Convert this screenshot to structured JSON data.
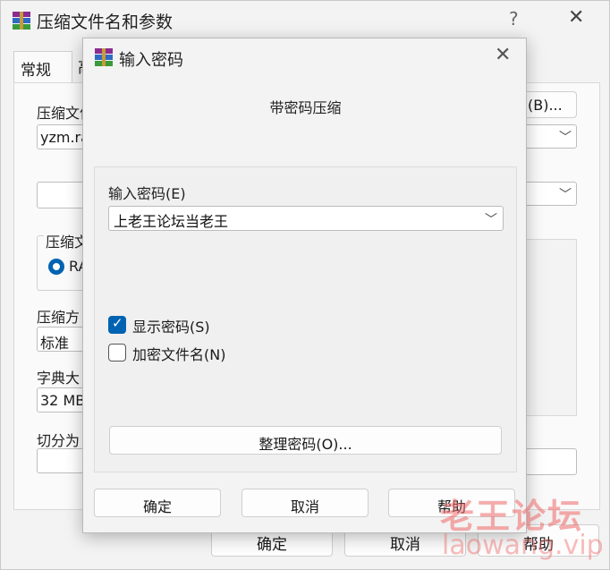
{
  "background_window": {
    "title": "压缩文件名和参数",
    "help_button": "?",
    "close_button": "✕",
    "tabs": [
      "常规",
      "高"
    ],
    "archive_name_label": "压缩文件",
    "archive_name_value": "yzm.ra",
    "browse_button": "(B)...",
    "archive_format_group": "压缩文",
    "archive_format_radio": "RA",
    "compression_method_label": "压缩方",
    "compression_method_value": "标准",
    "dictionary_size_label": "字典大",
    "dictionary_size_value": "32 MB",
    "split_label": "切分为",
    "buttons": {
      "ok": "确定",
      "cancel": "取消",
      "help": "帮助"
    }
  },
  "dialog": {
    "title": "输入密码",
    "close_button": "✕",
    "header": "带密码压缩",
    "password_label": "输入密码(E)",
    "password_value": "上老王论坛当老王",
    "show_password": {
      "label": "显示密码(S)",
      "checked": true
    },
    "encrypt_file_names": {
      "label": "加密文件名(N)",
      "checked": false
    },
    "organize_button": "整理密码(O)...",
    "buttons": {
      "ok": "确定",
      "cancel": "取消",
      "help": "帮助"
    }
  },
  "watermark": {
    "line1": "老王论坛",
    "line2": "laowang.vip"
  },
  "colors": {
    "accent": "#0063b1",
    "watermark": "#f06a6a"
  }
}
